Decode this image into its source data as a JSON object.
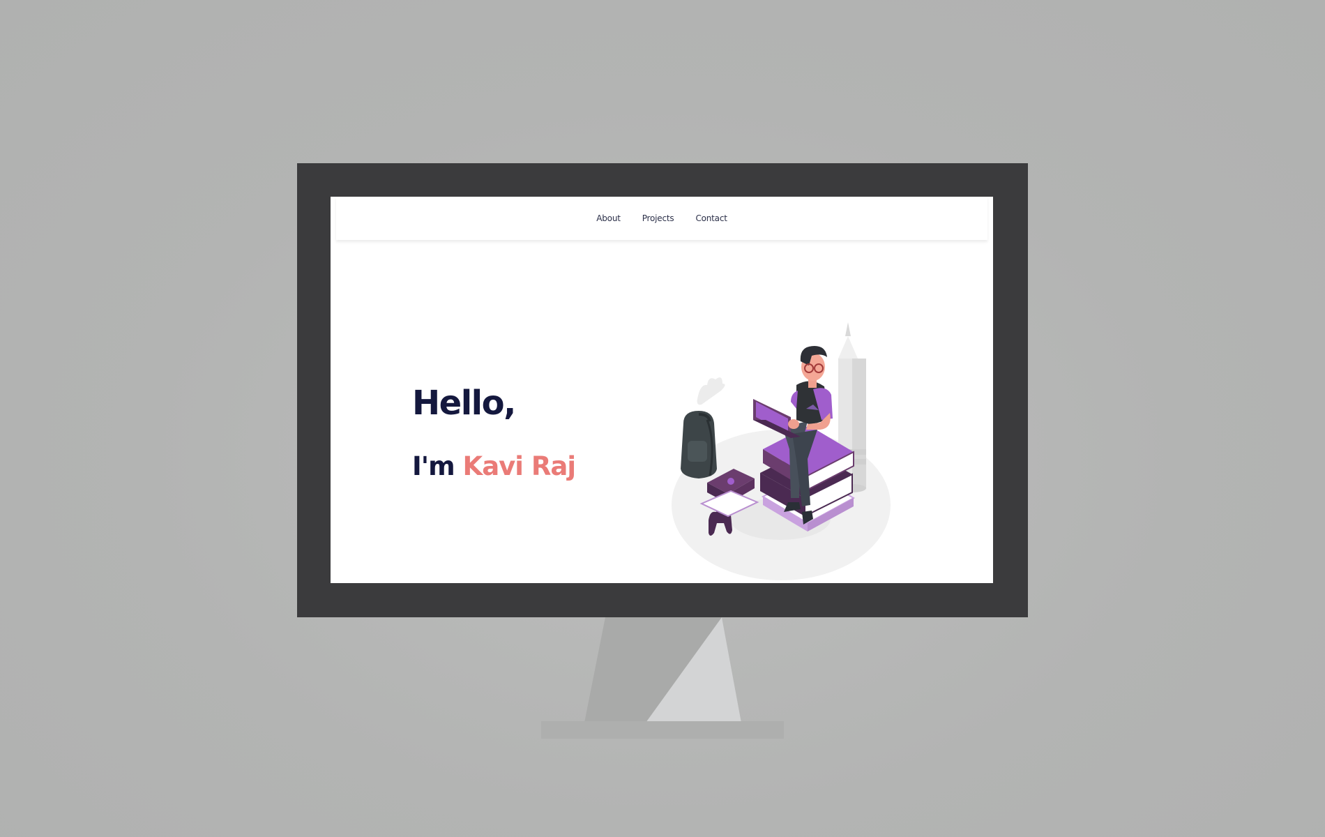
{
  "navbar": {
    "links": [
      {
        "label": "About"
      },
      {
        "label": "Projects"
      },
      {
        "label": "Contact"
      }
    ]
  },
  "hero": {
    "greeting": "Hello,",
    "intro_prefix": "I'm",
    "name": "Kavi Raj"
  },
  "colors": {
    "background": "#b3b4b3",
    "monitor_bezel": "#3b3b3d",
    "heading": "#14183e",
    "accent_name": "#ea7b77",
    "illustration_purple": "#a05ecc",
    "illustration_dark_purple": "#4b2a52"
  }
}
